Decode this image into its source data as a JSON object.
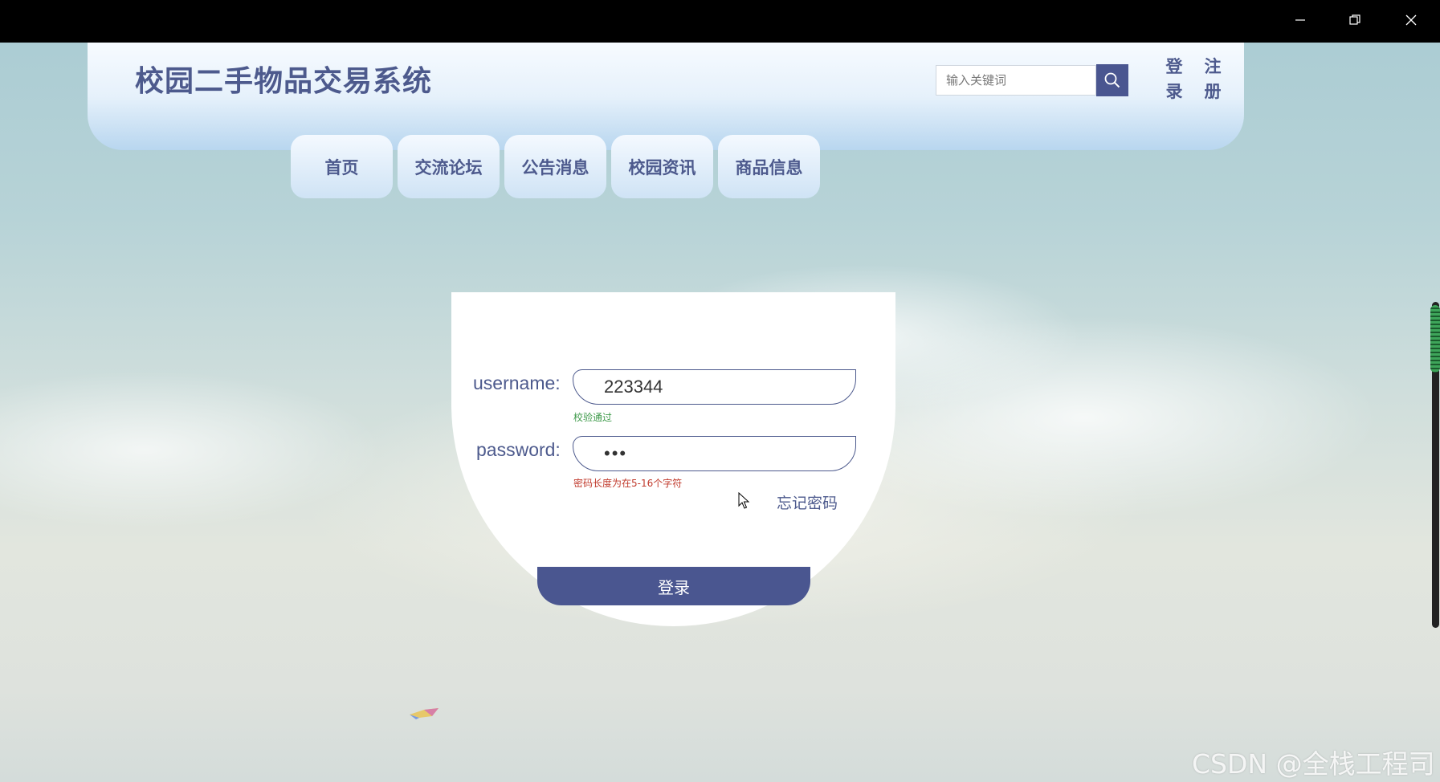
{
  "window": {
    "minimize_icon": "minimize-icon",
    "restore_icon": "restore-icon",
    "close_icon": "close-icon"
  },
  "header": {
    "site_title": "校园二手物品交易系统",
    "search": {
      "placeholder": "输入关键词",
      "value": "",
      "icon": "search-icon"
    },
    "login_link": "登录",
    "register_link": "注册"
  },
  "nav": {
    "items": [
      {
        "label": "首页"
      },
      {
        "label": "交流论坛"
      },
      {
        "label": "公告消息"
      },
      {
        "label": "校园资讯"
      },
      {
        "label": "商品信息"
      }
    ]
  },
  "login_form": {
    "username_label": "username:",
    "username_value": "223344",
    "username_hint": "校验通过",
    "password_label": "password:",
    "password_value": "•••",
    "password_hint": "密码长度为在5-16个字符",
    "forgot_link": "忘记密码",
    "submit_label": "登录"
  },
  "watermark": "CSDN @全栈工程司",
  "colors": {
    "brand": "#4a5690",
    "hint_ok": "#3e9a4a",
    "hint_err": "#c0392b"
  }
}
